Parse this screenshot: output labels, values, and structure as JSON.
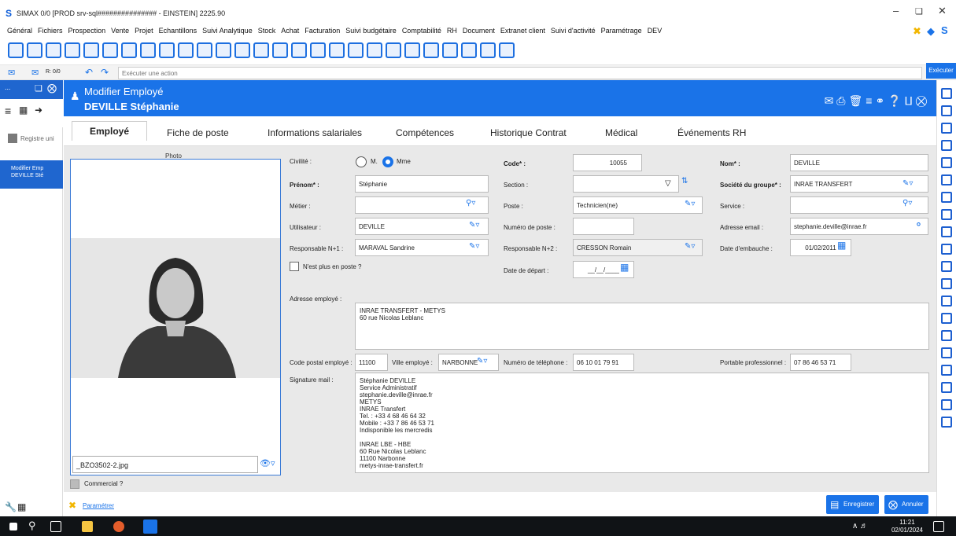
{
  "window": {
    "title": "SIMAX 0/0 [PROD srv-sql############### - EINSTEIN] 2225.90",
    "logo": "S"
  },
  "menu": [
    "Général",
    "Fichiers",
    "Prospection",
    "Vente",
    "Projet",
    "Echantillons",
    "Suivi Analytique",
    "Stock",
    "Achat",
    "Facturation",
    "Suivi budgétaire",
    "Comptabilité",
    "RH",
    "Document",
    "Extranet client",
    "Suivi d'activité",
    "Paramétrage",
    "DEV"
  ],
  "actionbar": {
    "counter": "R: 0/0",
    "action_placeholder": "Exécuter une action",
    "execute_label": "Exécuter"
  },
  "left": {
    "registry_label": "Registre uni",
    "selected_line1": "Modifier Emp",
    "selected_line2": "DEVILLE Sté"
  },
  "header": {
    "line1": "Modifier Employé",
    "line2": "DEVILLE Stéphanie"
  },
  "tabs": [
    "Employé",
    "Fiche de poste",
    "Informations salariales",
    "Compétences",
    "Historique Contrat",
    "Médical",
    "Événements RH"
  ],
  "photo": {
    "label": "Photo",
    "filename": "_BZO3502-2.jpg"
  },
  "form": {
    "civilite_label": "Civilité :",
    "civilite_m": "M.",
    "civilite_mme": "Mme",
    "code_label": "Code* :",
    "code_value": "10055",
    "nom_label": "Nom* :",
    "nom_value": "DEVILLE",
    "prenom_label": "Prénom* :",
    "prenom_value": "Stéphanie",
    "section_label": "Section :",
    "section_value": "",
    "societe_label": "Société du groupe* :",
    "societe_value": "INRAE TRANSFERT",
    "metier_label": "Métier :",
    "metier_value": "",
    "poste_label": "Poste :",
    "poste_value": "Technicien(ne)",
    "service_label": "Service :",
    "service_value": "",
    "utilisateur_label": "Utilisateur :",
    "utilisateur_value": "DEVILLE",
    "numposte_label": "Numéro de poste :",
    "numposte_value": "",
    "email_label": "Adresse email :",
    "email_value": "stephanie.deville@inrae.fr",
    "resp1_label": "Responsable N+1 :",
    "resp1_value": "MARAVAL Sandrine",
    "resp2_label": "Responsable N+2 :",
    "resp2_value": "CRESSON Romain",
    "embauche_label": "Date d'embauche :",
    "embauche_value": "01/02/2011",
    "nplus_label": "N'est plus en poste ?",
    "depart_label": "Date de départ :",
    "depart_value": "__/__/____",
    "adresse_label": "Adresse employé :",
    "adresse_lines": [
      "INRAE TRANSFERT - METYS",
      "60 rue Nicolas Leblanc"
    ],
    "cp_label": "Code postal employé :",
    "cp_value": "11100",
    "ville_label": "Ville employé :",
    "ville_value": "NARBONNE",
    "tel_label": "Numéro de téléphone :",
    "tel_value": "06 10 01 79 91",
    "portable_label": "Portable professionnel :",
    "portable_value": "07 86 46 53 71",
    "signature_label": "Signature mail :",
    "signature_lines": [
      "Stéphanie DEVILLE",
      "Service Administratif",
      "stephanie.deville@inrae.fr",
      "METYS",
      "INRAE Transfert",
      "Tel. : +33 4 68 46 64 32",
      "Mobile : +33 7 86 46 53 71",
      "Indisponible les mercredis",
      "",
      "INRAE LBE - HBE",
      "60 Rue Nicolas Leblanc",
      "11100 Narbonne",
      "metys-inrae-transfert.fr"
    ]
  },
  "commercial_label": "Commercial ?",
  "footer": {
    "parametrer": "Paramétrer",
    "save": "Enregistrer",
    "cancel": "Annuler"
  },
  "taskbar": {
    "time": "11:21",
    "date": "02/01/2024"
  },
  "colors": {
    "accent": "#1a73e8",
    "header": "#1a73e8",
    "taskbar": "#101316"
  }
}
